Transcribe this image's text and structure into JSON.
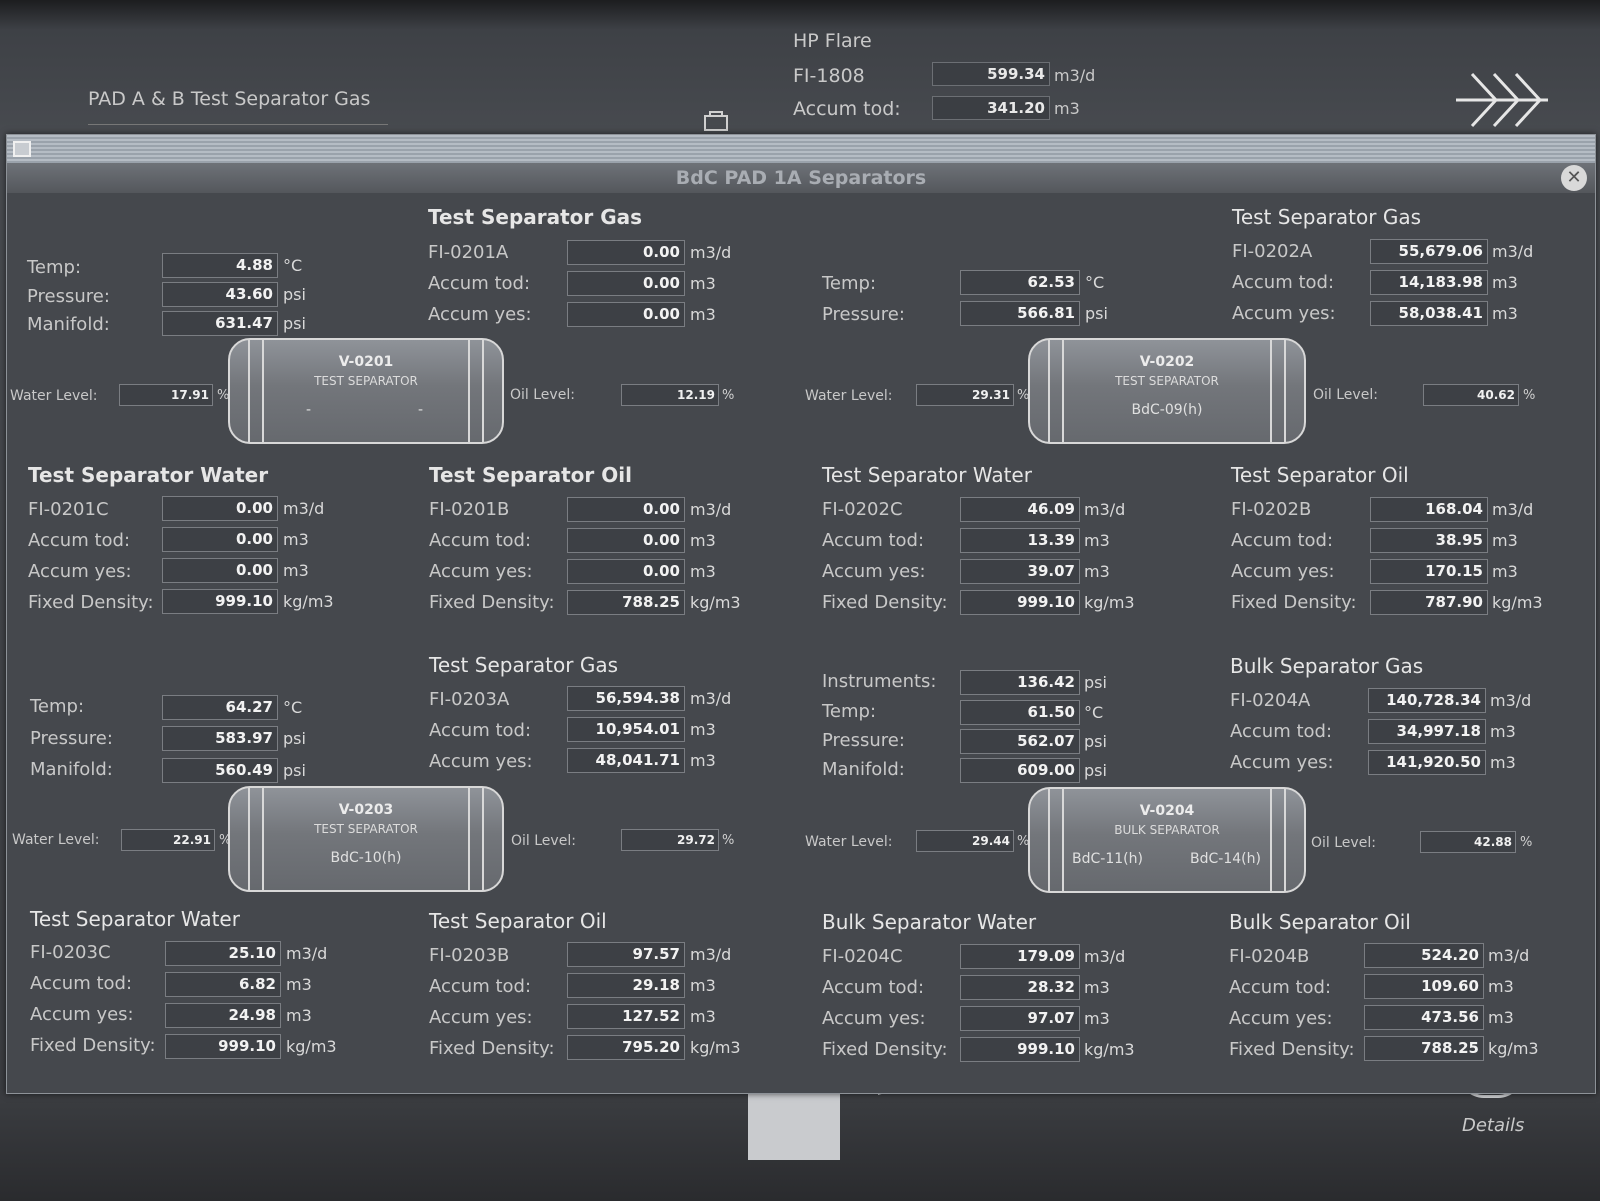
{
  "background": {
    "pad_title": "PAD A & B Test Separator Gas",
    "hp_flare": {
      "title": "HP Flare",
      "fi_label": "FI-1808",
      "fi_value": "599.34",
      "fi_unit": "m3/d",
      "accum_label": "Accum tod:",
      "accum_value": "341.20",
      "accum_unit": "m3"
    },
    "details_label": "Details"
  },
  "window": {
    "title": "BdC PAD 1A Separators"
  },
  "v0201": {
    "gas": {
      "title": "Test Separator Gas",
      "fi": "FI-0201A",
      "fi_value": "0.00",
      "accum_tod": "0.00",
      "accum_yes": "0.00"
    },
    "process": {
      "temp": "4.88",
      "pressure": "43.60",
      "manifold": "631.47"
    },
    "vessel": {
      "tag": "V-0201",
      "type": "TEST SEPARATOR",
      "left_mark": "-",
      "right_mark": "-"
    },
    "water_level": "17.91",
    "oil_level": "12.19",
    "water": {
      "title": "Test Separator Water",
      "fi": "FI-0201C",
      "fi_value": "0.00",
      "accum_tod": "0.00",
      "accum_yes": "0.00",
      "density": "999.10"
    },
    "oil": {
      "title": "Test Separator Oil",
      "fi": "FI-0201B",
      "fi_value": "0.00",
      "accum_tod": "0.00",
      "accum_yes": "0.00",
      "density": "788.25"
    }
  },
  "v0202": {
    "gas": {
      "title": "Test Separator Gas",
      "fi": "FI-0202A",
      "fi_value": "55,679.06",
      "accum_tod": "14,183.98",
      "accum_yes": "58,038.41"
    },
    "process": {
      "temp": "62.53",
      "pressure": "566.81"
    },
    "vessel": {
      "tag": "V-0202",
      "type": "TEST SEPARATOR",
      "well": "BdC-09(h)"
    },
    "water_level": "29.31",
    "oil_level": "40.62",
    "water": {
      "title": "Test Separator Water",
      "fi": "FI-0202C",
      "fi_value": "46.09",
      "accum_tod": "13.39",
      "accum_yes": "39.07",
      "density": "999.10"
    },
    "oil": {
      "title": "Test Separator Oil",
      "fi": "FI-0202B",
      "fi_value": "168.04",
      "accum_tod": "38.95",
      "accum_yes": "170.15",
      "density": "787.90"
    }
  },
  "v0203": {
    "gas": {
      "title": "Test Separator Gas",
      "fi": "FI-0203A",
      "fi_value": "56,594.38",
      "accum_tod": "10,954.01",
      "accum_yes": "48,041.71"
    },
    "process": {
      "temp": "64.27",
      "pressure": "583.97",
      "manifold": "560.49"
    },
    "vessel": {
      "tag": "V-0203",
      "type": "TEST SEPARATOR",
      "well": "BdC-10(h)"
    },
    "water_level": "22.91",
    "oil_level": "29.72",
    "water": {
      "title": "Test Separator Water",
      "fi": "FI-0203C",
      "fi_value": "25.10",
      "accum_tod": "6.82",
      "accum_yes": "24.98",
      "density": "999.10"
    },
    "oil": {
      "title": "Test Separator Oil",
      "fi": "FI-0203B",
      "fi_value": "97.57",
      "accum_tod": "29.18",
      "accum_yes": "127.52",
      "density": "795.20"
    }
  },
  "v0204": {
    "gas": {
      "title": "Bulk Separator Gas",
      "fi": "FI-0204A",
      "fi_value": "140,728.34",
      "accum_tod": "34,997.18",
      "accum_yes": "141,920.50"
    },
    "process": {
      "instruments": "136.42",
      "temp": "61.50",
      "pressure": "562.07",
      "manifold": "609.00"
    },
    "vessel": {
      "tag": "V-0204",
      "type": "BULK SEPARATOR",
      "well_left": "BdC-11(h)",
      "well_right": "BdC-14(h)"
    },
    "water_level": "29.44",
    "oil_level": "42.88",
    "water": {
      "title": "Bulk Separator Water",
      "fi": "FI-0204C",
      "fi_value": "179.09",
      "accum_tod": "28.32",
      "accum_yes": "97.07",
      "density": "999.10"
    },
    "oil": {
      "title": "Bulk Separator Oil",
      "fi": "FI-0204B",
      "fi_value": "524.20",
      "accum_tod": "109.60",
      "accum_yes": "473.56",
      "density": "788.25"
    }
  },
  "labels": {
    "temp": "Temp:",
    "pressure": "Pressure:",
    "manifold": "Manifold:",
    "instruments": "Instruments:",
    "accum_tod": "Accum tod:",
    "accum_yes": "Accum yes:",
    "fixed_density": "Fixed Density:",
    "water_level": "Water Level:",
    "oil_level": "Oil Level:"
  },
  "units": {
    "flow": "m3/d",
    "volume": "m3",
    "density": "kg/m3",
    "celsius": "°C",
    "psi": "psi",
    "percent": "%"
  }
}
